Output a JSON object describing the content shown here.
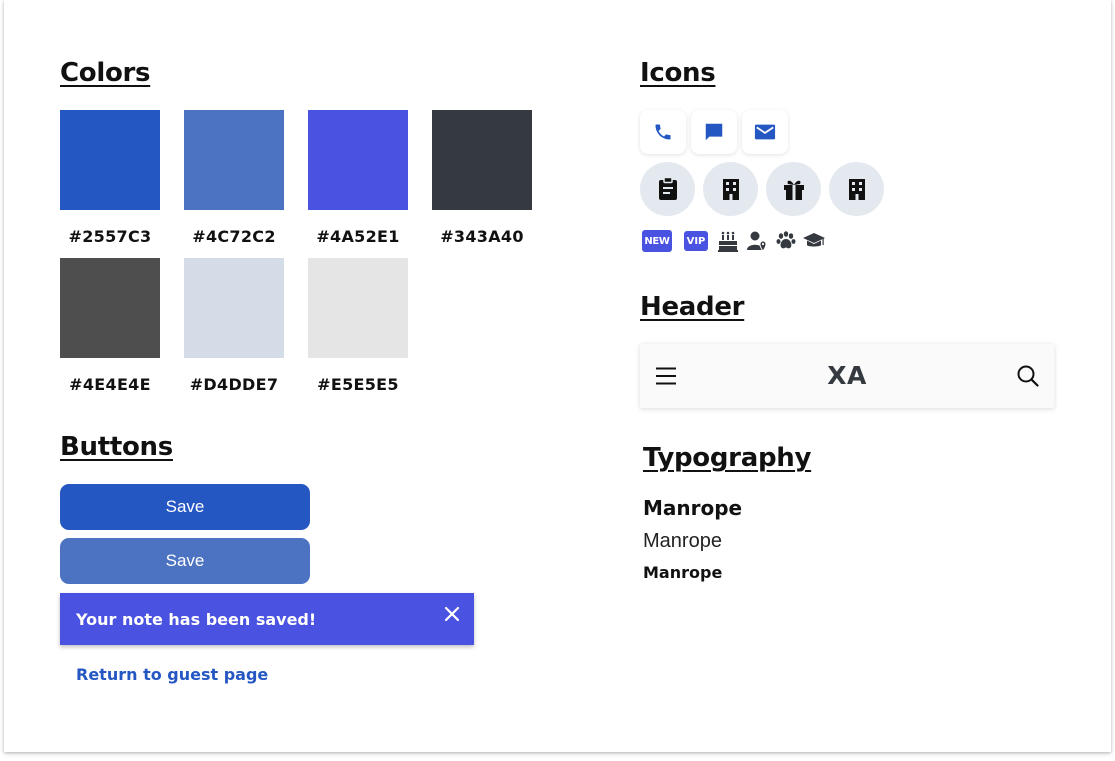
{
  "sections": {
    "colors": "Colors",
    "buttons": "Buttons",
    "icons": "Icons",
    "header": "Header",
    "typography": "Typography"
  },
  "colors": [
    {
      "hex": "#2557C3",
      "label": "#2557C3"
    },
    {
      "hex": "#4C72C2",
      "label": "#4C72C2"
    },
    {
      "hex": "#4A52E1",
      "label": "#4A52E1"
    },
    {
      "hex": "#343A40",
      "label": "#343A40"
    },
    {
      "hex": "#4E4E4E",
      "label": "#4E4E4E"
    },
    {
      "hex": "#D4DDE7",
      "label": "#D4DDE7"
    },
    {
      "hex": "#E5E5E5",
      "label": "#E5E5E5"
    }
  ],
  "buttons": {
    "primary_label": "Save",
    "secondary_label": "Save"
  },
  "toast": {
    "message": "Your note has been saved!"
  },
  "link": {
    "label": "Return to guest page"
  },
  "icons": {
    "square": [
      "phone-icon",
      "chat-icon",
      "mail-icon"
    ],
    "circle": [
      "clipboard-icon",
      "building-icon",
      "gift-icon",
      "building-icon"
    ],
    "small": [
      "new-badge-icon",
      "vip-badge-icon",
      "birthday-cake-icon",
      "person-location-icon",
      "paw-icon",
      "graduation-cap-icon"
    ],
    "new_badge": "NEW",
    "vip_badge": "VIP"
  },
  "header_bar": {
    "brand": "XA",
    "menu_icon": "hamburger-menu-icon",
    "search_icon": "search-icon"
  },
  "typography": {
    "sample_bold": "Manrope",
    "sample_regular": "Manrope",
    "sample_small": "Manrope"
  },
  "theme": {
    "primary": "#2557C3",
    "secondary": "#4C72C2",
    "accent": "#4A52E1",
    "dark": "#343A40"
  }
}
